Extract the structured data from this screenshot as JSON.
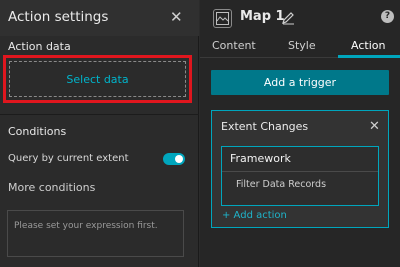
{
  "left_panel": {
    "title": "Action settings",
    "action_data_label": "Action data",
    "select_data_label": "Select data",
    "conditions_label": "Conditions",
    "query_label": "Query by current extent",
    "query_toggle_on": true,
    "more_conditions_label": "More conditions",
    "expression_placeholder": "Please set your expression first."
  },
  "right_panel": {
    "widget_title": "Map 1",
    "tabs": [
      {
        "label": "Content",
        "active": false
      },
      {
        "label": "Style",
        "active": false
      },
      {
        "label": "Action",
        "active": true
      }
    ],
    "add_trigger_label": "Add a trigger",
    "trigger_card": {
      "title": "Extent Changes",
      "target": "Framework",
      "action": "Filter Data Records",
      "add_action_label": "+ Add action"
    }
  },
  "colors": {
    "accent": "#00a6bd",
    "primary_button": "#00788a",
    "highlight_box": "#e0161e",
    "panel_bg": "#2b2b2b"
  },
  "icons": {
    "close": "close-icon",
    "map": "map-icon",
    "edit": "pencil-icon",
    "help": "help-icon"
  }
}
